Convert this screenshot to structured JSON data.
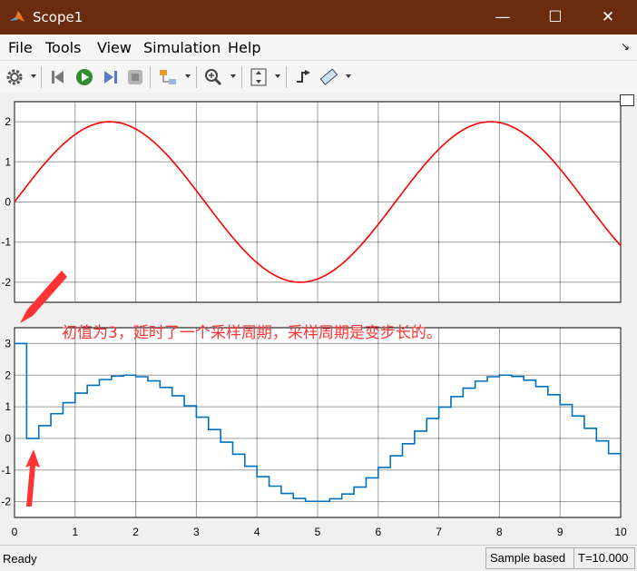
{
  "window": {
    "title": "Scope1",
    "minimize": "—",
    "maximize": "☐",
    "close": "✕"
  },
  "menu": [
    "File",
    "Tools",
    "View",
    "Simulation",
    "Help"
  ],
  "toolbar_icons": [
    "gear-icon",
    "step-back-icon",
    "run-icon",
    "step-forward-icon",
    "stop-icon",
    "highlight-simulink-block-icon",
    "zoom-icon",
    "autoscale-icon",
    "triggers-icon",
    "measurements-icon"
  ],
  "colors": {
    "titlebar": "#6b2b0e",
    "signal_top": "#ff0000",
    "signal_bottom": "#0072bd",
    "annotation": "#ff3333"
  },
  "annotation": "初值为3，延时了一个采样周期，采样周期是变步长的。",
  "status": {
    "left": "Ready",
    "sample_mode": "Sample based",
    "time": "T=10.000"
  },
  "chart_data": [
    {
      "type": "line",
      "series": [
        {
          "name": "",
          "function": "2*sin(t)",
          "t_start": 0,
          "t_end": 10
        }
      ],
      "xlim": [
        0,
        10
      ],
      "ylim": [
        -2.5,
        2.5
      ],
      "xticks": [
        0,
        1,
        2,
        3,
        4,
        5,
        6,
        7,
        8,
        9,
        10
      ],
      "yticks": [
        -2,
        -1,
        0,
        1,
        2
      ],
      "grid": true,
      "xlabel": "",
      "ylabel": "",
      "title": ""
    },
    {
      "type": "line",
      "step": true,
      "series": [
        {
          "name": "",
          "x": [
            0,
            0.2,
            0.4,
            0.6,
            0.8,
            1.0,
            1.2,
            1.4,
            1.6,
            1.8,
            2.0,
            2.2,
            2.4,
            2.6,
            2.8,
            3.0,
            3.2,
            3.4,
            3.6,
            3.8,
            4.0,
            4.2,
            4.4,
            4.6,
            4.8,
            5.0,
            5.2,
            5.4,
            5.6,
            5.8,
            6.0,
            6.2,
            6.4,
            6.6,
            6.8,
            7.0,
            7.2,
            7.4,
            7.6,
            7.8,
            8.0,
            8.2,
            8.4,
            8.6,
            8.8,
            9.0,
            9.2,
            9.4,
            9.6,
            9.8,
            10.0
          ],
          "values": [
            3,
            0,
            0.4,
            0.78,
            1.13,
            1.43,
            1.68,
            1.86,
            1.97,
            2.0,
            1.95,
            1.82,
            1.61,
            1.35,
            1.03,
            0.67,
            0.28,
            -0.12,
            -0.5,
            -0.88,
            -1.21,
            -1.51,
            -1.74,
            -1.9,
            -1.99,
            -1.99,
            -1.91,
            -1.76,
            -1.54,
            -1.25,
            -0.92,
            -0.55,
            -0.17,
            0.23,
            0.63,
            0.99,
            1.32,
            1.59,
            1.81,
            1.95,
            2.0,
            1.96,
            1.84,
            1.64,
            1.38,
            1.07,
            0.71,
            0.32,
            -0.08,
            -0.48,
            -0.54
          ]
        }
      ],
      "xlim": [
        0,
        10
      ],
      "ylim": [
        -2.5,
        3.5
      ],
      "xticks": [
        0,
        1,
        2,
        3,
        4,
        5,
        6,
        7,
        8,
        9,
        10
      ],
      "yticks": [
        -2,
        -1,
        0,
        1,
        2,
        3
      ],
      "grid": true,
      "xlabel": "",
      "ylabel": "",
      "title": ""
    }
  ]
}
